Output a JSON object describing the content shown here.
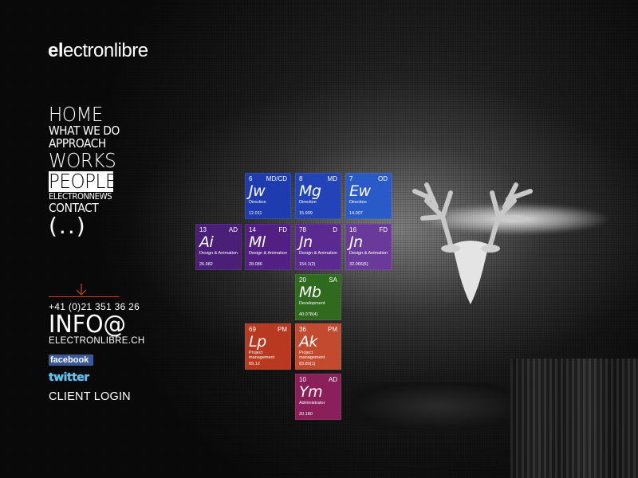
{
  "brand": {
    "logo_bold": "el",
    "logo_rest": "ectronlibre"
  },
  "nav": [
    {
      "label": "HOME",
      "size": "big"
    },
    {
      "label": "WHAT WE DO",
      "size": "mid"
    },
    {
      "label": "APPROACH",
      "size": "mid"
    },
    {
      "label": "WORKS",
      "size": "big"
    },
    {
      "label": "PEOPLE",
      "size": "big",
      "active": true
    },
    {
      "label": "ELECTRONNEWS",
      "size": "small"
    },
    {
      "label": "CONTACT",
      "size": "mid"
    },
    {
      "label": "(..)",
      "size": "dots"
    }
  ],
  "contact": {
    "phone": "+41 (0)21 351 36 26",
    "info": "INFO@",
    "domain": "ELECTRONLIBRE.CH"
  },
  "social": {
    "facebook": "facebook",
    "twitter": "twitter"
  },
  "client_login": "CLIENT LOGIN",
  "tiles": [
    {
      "num": "6",
      "code": "MD/CD",
      "sym": "Jw",
      "role": "Direction",
      "mass": "12.011",
      "color": "#1f3bb0"
    },
    {
      "num": "8",
      "code": "MD",
      "sym": "Mg",
      "role": "Direction",
      "mass": "15.999",
      "color": "#2244b8"
    },
    {
      "num": "7",
      "code": "OD",
      "sym": "Ew",
      "role": "Direction",
      "mass": "14.007",
      "color": "#2a5ac8"
    },
    {
      "num": "13",
      "code": "AD",
      "sym": "Ai",
      "role": "Design & Animation",
      "mass": "26.982",
      "color": "#4a1f78"
    },
    {
      "num": "14",
      "code": "FD",
      "sym": "Ml",
      "role": "Design & Animation",
      "mass": "28.086",
      "color": "#521f82"
    },
    {
      "num": "78",
      "code": "D",
      "sym": "Jn",
      "role": "Design & Animation",
      "mass": "154.1(2)",
      "color": "#5a2a90"
    },
    {
      "num": "16",
      "code": "FD",
      "sym": "Jn",
      "role": "Design & Animation",
      "mass": "32.066(6)",
      "color": "#6a3a9a"
    },
    {
      "num": "20",
      "code": "SA",
      "sym": "Mb",
      "role": "Development",
      "mass": "40.078(4)",
      "color": "#2f6a1e"
    },
    {
      "num": "69",
      "code": "PM",
      "sym": "Lp",
      "role": "Project management",
      "mass": "69.12",
      "color": "#b8391f"
    },
    {
      "num": "36",
      "code": "PM",
      "sym": "Ak",
      "role": "Project management",
      "mass": "83.80(1)",
      "color": "#c24a2e"
    },
    {
      "num": "10",
      "code": "AD",
      "sym": "Ym",
      "role": "Administrator",
      "mass": "20.180",
      "color": "#8a1f5a"
    }
  ]
}
